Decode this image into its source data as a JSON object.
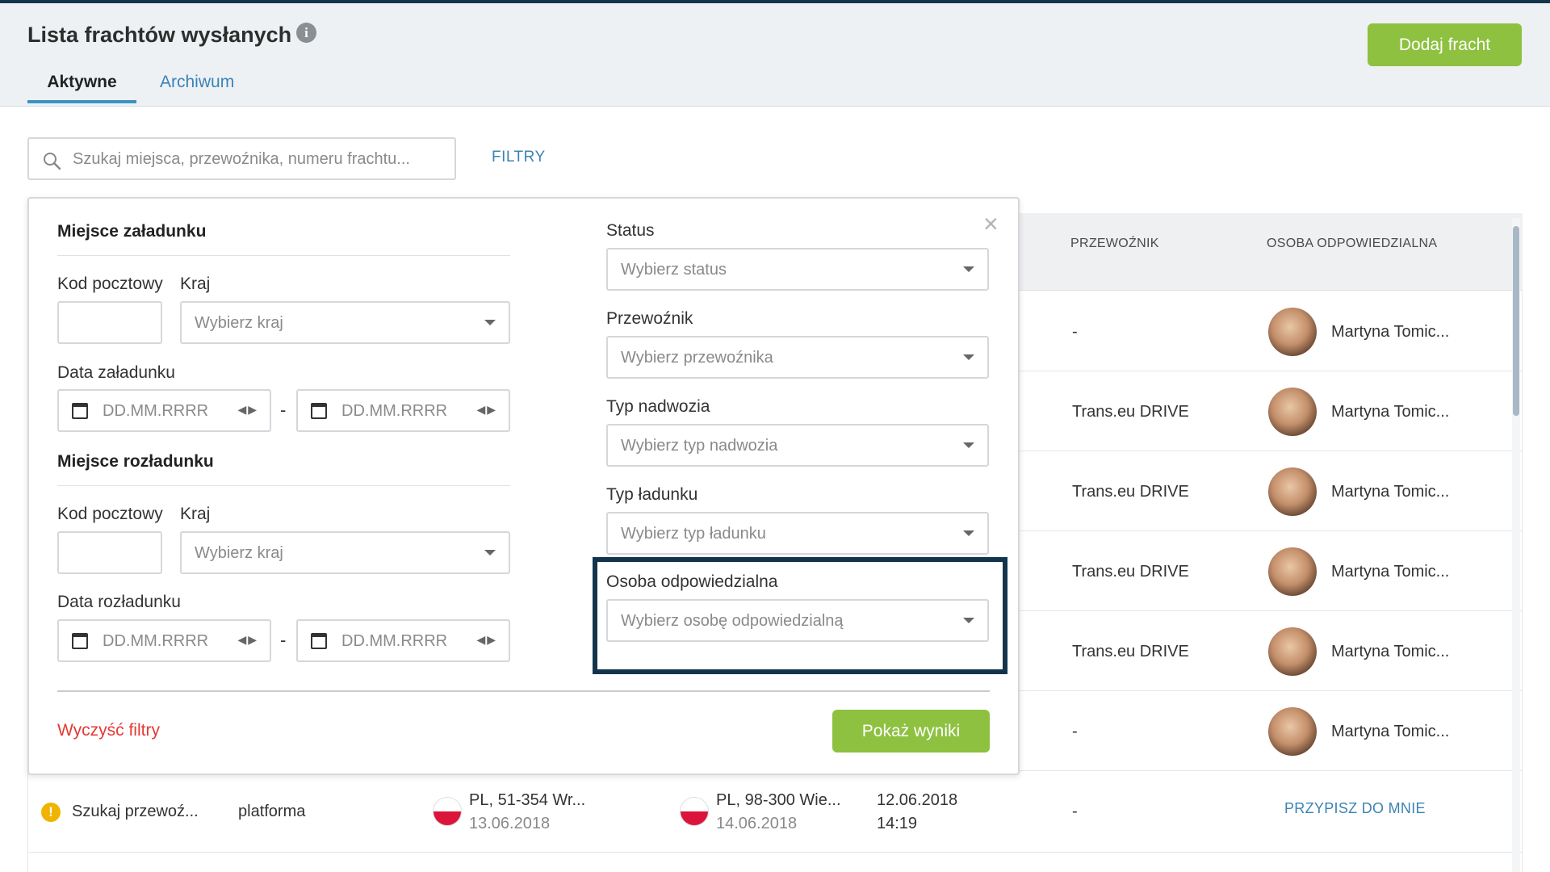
{
  "header": {
    "title": "Lista frachtów wysłanych",
    "info_icon": "i",
    "add_button": "Dodaj fracht",
    "tabs": [
      {
        "label": "Aktywne",
        "active": true
      },
      {
        "label": "Archiwum",
        "active": false
      }
    ]
  },
  "search": {
    "placeholder": "Szukaj miejsca, przewoźnika, numeru frachtu...",
    "filters_link": "FILTRY"
  },
  "table": {
    "columns": {
      "carrier": "PRZEWOŹNIK",
      "responsible": "OSOBA ODPOWIEDZIALNA"
    },
    "rows": [
      {
        "carrier": "-",
        "responsible": "Martyna Tomic..."
      },
      {
        "carrier": "Trans.eu DRIVE",
        "responsible": "Martyna Tomic..."
      },
      {
        "carrier": "Trans.eu DRIVE",
        "responsible": "Martyna Tomic..."
      },
      {
        "carrier": "Trans.eu DRIVE",
        "responsible": "Martyna Tomic..."
      },
      {
        "carrier": "Trans.eu DRIVE",
        "responsible": "Martyna Tomic..."
      },
      {
        "carrier": "-",
        "responsible": "Martyna Tomic..."
      }
    ],
    "last_row": {
      "warning_icon": "!",
      "status": "Szukaj przewoź...",
      "source": "platforma",
      "loading_place": "PL, 51-354 Wr...",
      "loading_date": "13.06.2018",
      "unloading_place": "PL, 98-300 Wie...",
      "unloading_date": "14.06.2018",
      "created_date": "12.06.2018",
      "created_time": "14:19",
      "carrier": "-",
      "assign_link": "PRZYPISZ DO MNIE"
    }
  },
  "filters": {
    "loading": {
      "title": "Miejsce załadunku",
      "postal_label": "Kod pocztowy",
      "country_label": "Kraj",
      "country_placeholder": "Wybierz kraj",
      "date_label": "Data załadunku",
      "date_from_placeholder": "DD.MM.RRRR",
      "date_to_placeholder": "DD.MM.RRRR"
    },
    "unloading": {
      "title": "Miejsce rozładunku",
      "postal_label": "Kod pocztowy",
      "country_label": "Kraj",
      "country_placeholder": "Wybierz kraj",
      "date_label": "Data rozładunku",
      "date_from_placeholder": "DD.MM.RRRR",
      "date_to_placeholder": "DD.MM.RRRR"
    },
    "date_separator": "-",
    "status": {
      "label": "Status",
      "placeholder": "Wybierz status"
    },
    "carrier": {
      "label": "Przewoźnik",
      "placeholder": "Wybierz przewoźnika"
    },
    "body_type": {
      "label": "Typ nadwozia",
      "placeholder": "Wybierz typ nadwozia"
    },
    "load_type": {
      "label": "Typ ładunku",
      "placeholder": "Wybierz typ ładunku"
    },
    "responsible": {
      "label": "Osoba odpowiedzialna",
      "placeholder": "Wybierz osobę odpowiedzialną"
    },
    "clear": "Wyczyść filtry",
    "submit": "Pokaż wyniki",
    "close_icon": "×"
  },
  "colors": {
    "accent_green": "#8ec140",
    "link_blue": "#3b83b5",
    "highlight_navy": "#13354c",
    "clear_red": "#e53935"
  }
}
